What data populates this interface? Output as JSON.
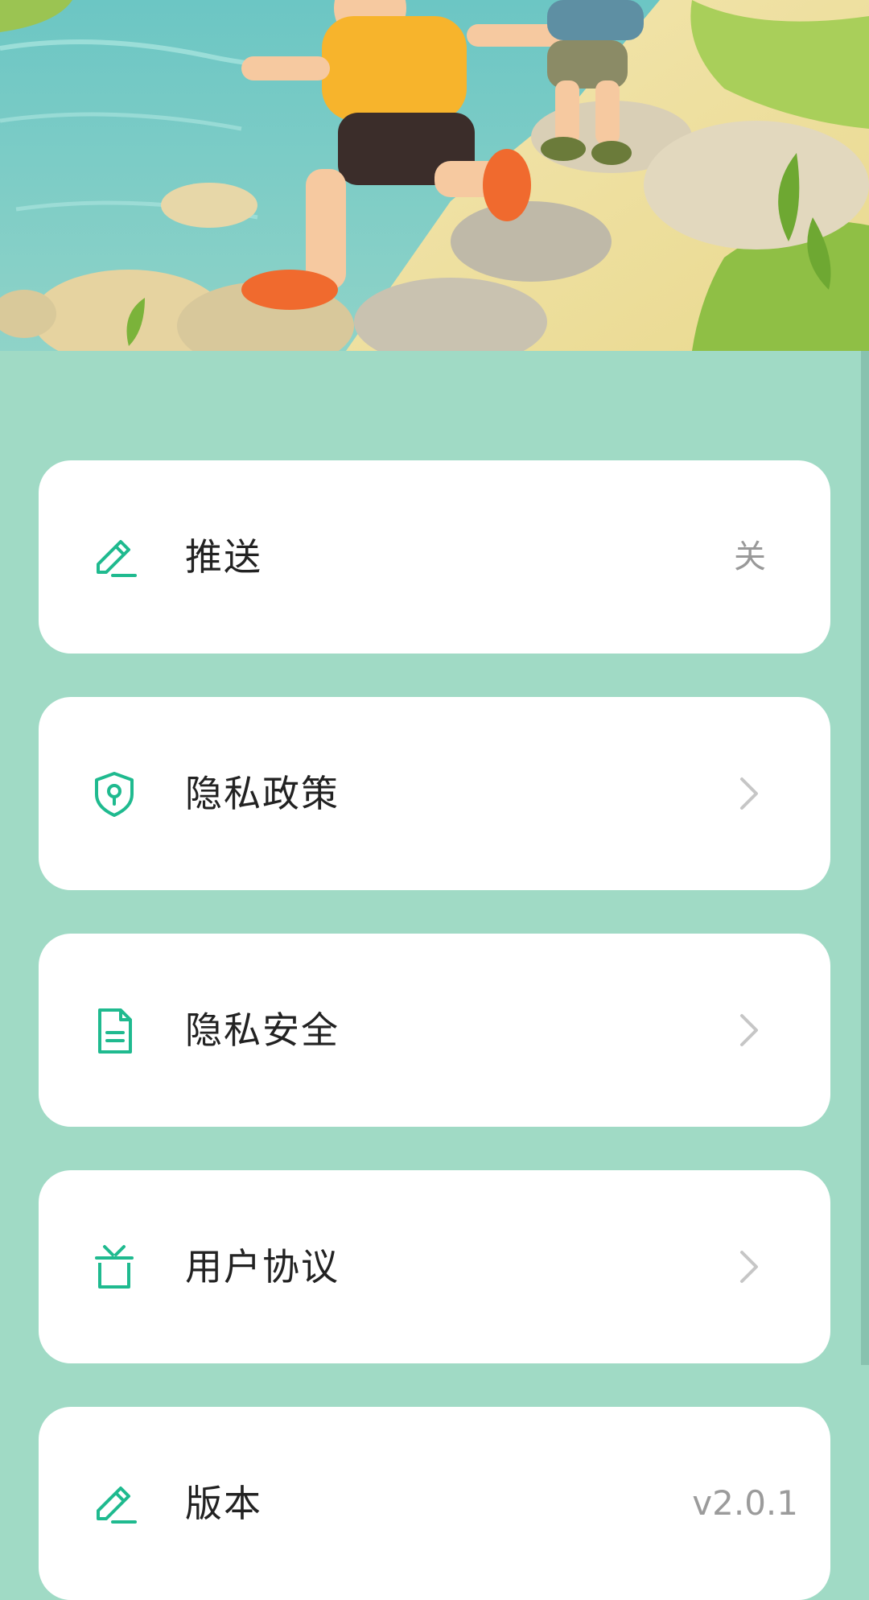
{
  "accent_color": "#1fba8f",
  "background_color": "#a0dac5",
  "hero": {
    "image": "illustration of children hiking and jumping over rocks by a stream"
  },
  "settings": [
    {
      "icon": "pencil-icon",
      "label": "推送",
      "value": "关",
      "type": "value"
    },
    {
      "icon": "shield-lock-icon",
      "label": "隐私政策",
      "type": "link"
    },
    {
      "icon": "document-icon",
      "label": "隐私安全",
      "type": "link"
    },
    {
      "icon": "gift-icon",
      "label": "用户协议",
      "type": "link"
    },
    {
      "icon": "pencil-icon",
      "label": "版本",
      "value": "v2.0.1",
      "type": "value"
    }
  ]
}
